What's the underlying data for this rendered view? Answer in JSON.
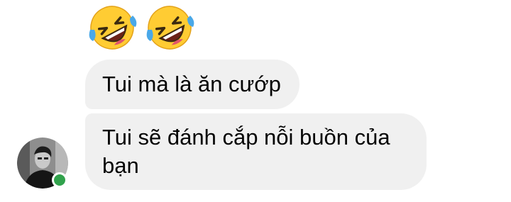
{
  "conversation": {
    "reaction_emojis": [
      {
        "icon": "rolling-on-floor-laughing-icon",
        "glyph": "🤣"
      },
      {
        "icon": "rolling-on-floor-laughing-icon",
        "glyph": "🤣"
      }
    ],
    "messages": [
      {
        "text": "Tui mà là ăn cướp"
      },
      {
        "text": "Tui sẽ đánh cắp nỗi buồn của bạn"
      }
    ],
    "sender": {
      "avatar_icon": "user-avatar",
      "presence": "online",
      "presence_color": "#31a24c"
    }
  },
  "colors": {
    "bubble_background": "#f0f0f0",
    "text": "#050505",
    "emoji_face": "#ffcc33",
    "emoji_tears": "#4aa8e8"
  }
}
